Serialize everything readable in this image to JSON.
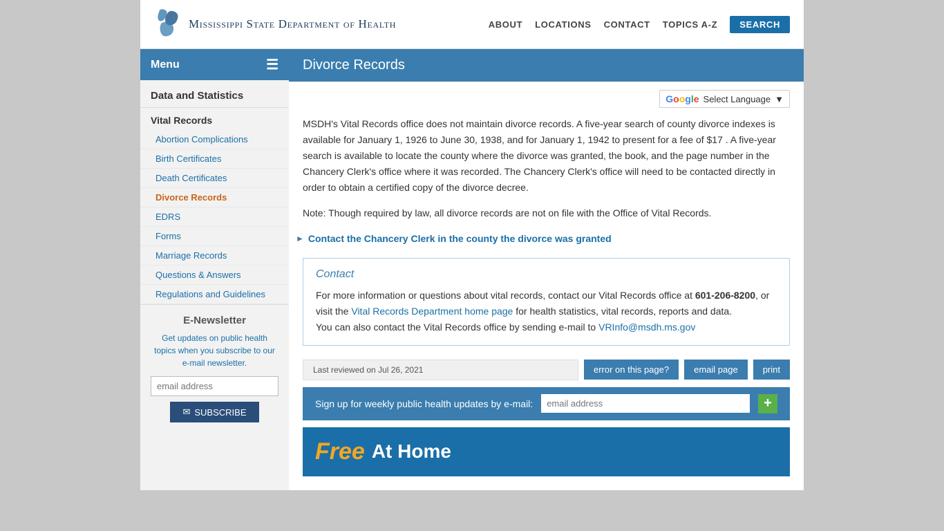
{
  "header": {
    "logo_text": "Mississippi State Department of Health",
    "nav": {
      "about": "ABOUT",
      "locations": "LOCATIONS",
      "contact": "CONTACT",
      "topics_az": "TOPICS A-Z",
      "search": "SEARCH"
    }
  },
  "sidebar": {
    "menu_label": "Menu",
    "section_title": "Data and Statistics",
    "category_vital": "Vital Records",
    "items": [
      {
        "label": "Abortion Complications",
        "active": false
      },
      {
        "label": "Birth Certificates",
        "active": false
      },
      {
        "label": "Death Certificates",
        "active": false
      },
      {
        "label": "Divorce Records",
        "active": true
      },
      {
        "label": "EDRS",
        "active": false
      },
      {
        "label": "Forms",
        "active": false
      },
      {
        "label": "Marriage Records",
        "active": false
      },
      {
        "label": "Questions & Answers",
        "active": false
      },
      {
        "label": "Regulations and Guidelines",
        "active": false
      }
    ],
    "enewsletter": {
      "title": "E-Newsletter",
      "description": "Get updates on public health topics when you subscribe to our e-mail newsletter.",
      "email_placeholder": "email address",
      "subscribe_label": "SUBSCRIBE"
    }
  },
  "main": {
    "page_title": "Divorce Records",
    "translate_label": "Select Language",
    "body_p1": "MSDH's Vital Records office does not maintain divorce records. A five-year search of county divorce indexes is available for January 1, 1926 to June 30, 1938, and for January 1, 1942 to present for a fee of $17 . A five-year search is available to locate the county where the divorce was granted, the book, and the page number in the Chancery Clerk's office where it was recorded. The Chancery Clerk's office will need to be contacted directly in order to obtain a certified copy of the divorce decree.",
    "body_note": "Note: Though required by law, all divorce records are not on file with the Office of Vital Records.",
    "chancery_link": "Contact the Chancery Clerk in the county the divorce was granted",
    "contact_section": {
      "title": "Contact",
      "text_before_phone": "For more information or questions about vital records, contact our Vital Records office at ",
      "phone": "601-206-8200",
      "text_after_phone": ", or visit the ",
      "vr_link_text": "Vital Records Department home page",
      "text_after_link": " for health statistics, vital records, reports and data.",
      "email_text": "You can also contact the Vital Records office by sending e-mail to ",
      "email_address": "VRInfo@msdh.ms.gov"
    },
    "footer": {
      "last_reviewed": "Last reviewed on Jul 26, 2021",
      "error_btn": "error on this page?",
      "email_btn": "email page",
      "print_btn": "print"
    },
    "signup_strip": {
      "label": "Sign up for weekly public health updates by e-mail:",
      "email_placeholder": "email address"
    },
    "bottom_banner": {
      "free": "Free",
      "rest": "At Home"
    }
  }
}
